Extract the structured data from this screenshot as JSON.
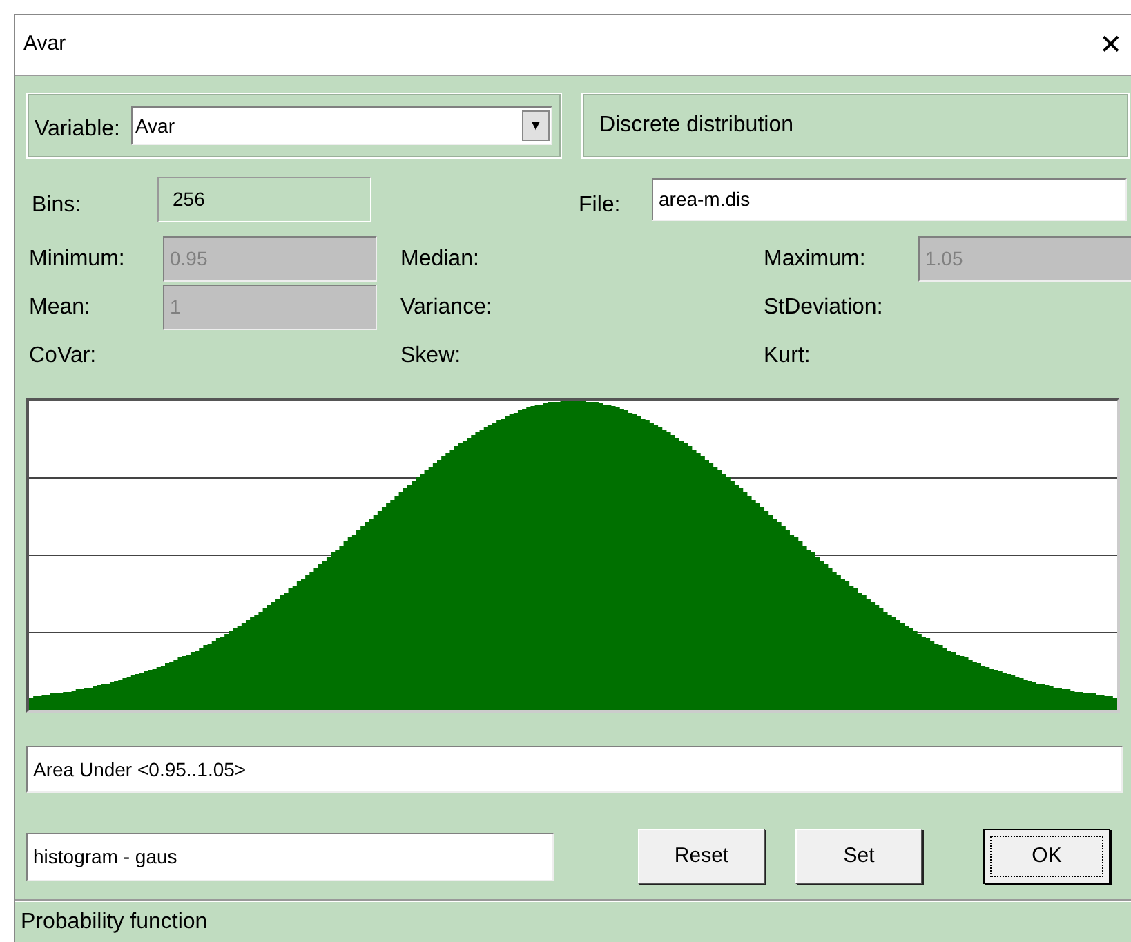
{
  "window": {
    "title": "Avar",
    "close": "✕"
  },
  "variable": {
    "label": "Variable:",
    "value": "Avar",
    "arrow": "▼"
  },
  "distribution_type": "Discrete distribution",
  "bins": {
    "label": "Bins:",
    "value": "256",
    "disabled": false
  },
  "file": {
    "label": "File:",
    "value": "area-m.dis"
  },
  "stats": [
    {
      "label": "Minimum:",
      "value": "0.95",
      "disabled": true
    },
    {
      "label": "Median:"
    },
    {
      "label": "Maximum:",
      "value": "1.05",
      "disabled": true
    },
    {
      "label": "Mean:",
      "value": "1",
      "disabled": true
    },
    {
      "label": "Variance:"
    },
    {
      "label": "StDeviation:"
    },
    {
      "label": "CoVar:"
    },
    {
      "label": "Skew:"
    },
    {
      "label": "Kurt:"
    }
  ],
  "area_under": {
    "value": "Area Under <0.95..1.05>"
  },
  "name_field": {
    "value": "histogram - gaus"
  },
  "buttons": [
    {
      "label": "Reset",
      "default": false
    },
    {
      "label": "Set",
      "default": false
    },
    {
      "label": "OK",
      "default": true
    }
  ],
  "status_bar": "Probability function"
}
